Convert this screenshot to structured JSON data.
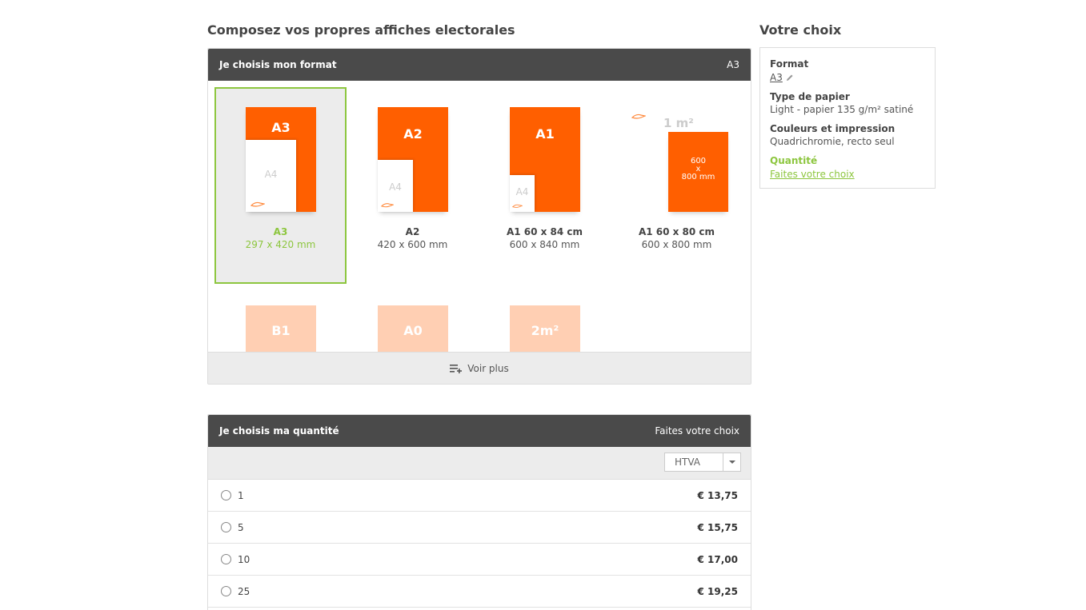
{
  "page_title": "Composez vos propres affiches electorales",
  "format_panel": {
    "header_title": "Je choisis mon format",
    "header_value": "A3",
    "formats": [
      {
        "poster_label": "A3",
        "sheet_label": "A4",
        "name": "A3",
        "size": "297 x 420 mm",
        "selected": true
      },
      {
        "poster_label": "A2",
        "sheet_label": "A4",
        "name": "A2",
        "size": "420 x 600 mm"
      },
      {
        "poster_label": "A1",
        "sheet_label": "A4",
        "name": "A1 60 x 84 cm",
        "size": "600 x 840 mm"
      },
      {
        "area_label": "1 m²",
        "poster_text": [
          "600",
          "x",
          "800 mm"
        ],
        "name": "A1 60 x 80 cm",
        "size": "600 x 800 mm"
      }
    ],
    "more_formats": [
      "B1",
      "A0",
      "2m²"
    ],
    "voir_plus_label": "Voir plus",
    "accent_color": "#ff5f00",
    "selected_color": "#8dc63f"
  },
  "quantity_panel": {
    "header_title": "Je choisis ma quantité",
    "header_value": "Faites votre choix",
    "tax_select": "HTVA",
    "rows": [
      {
        "qty": "1",
        "price": "€ 13,75"
      },
      {
        "qty": "5",
        "price": "€ 15,75"
      },
      {
        "qty": "10",
        "price": "€ 17,00"
      },
      {
        "qty": "25",
        "price": "€ 19,25"
      }
    ]
  },
  "summary": {
    "title": "Votre choix",
    "format_label": "Format",
    "format_value": "A3",
    "paper_label": "Type de papier",
    "paper_value": "Light - papier 135 g/m² satiné",
    "colors_label": "Couleurs et impression",
    "colors_value": "Quadrichromie, recto seul",
    "quantity_label": "Quantité",
    "quantity_value": "Faites votre choix"
  }
}
